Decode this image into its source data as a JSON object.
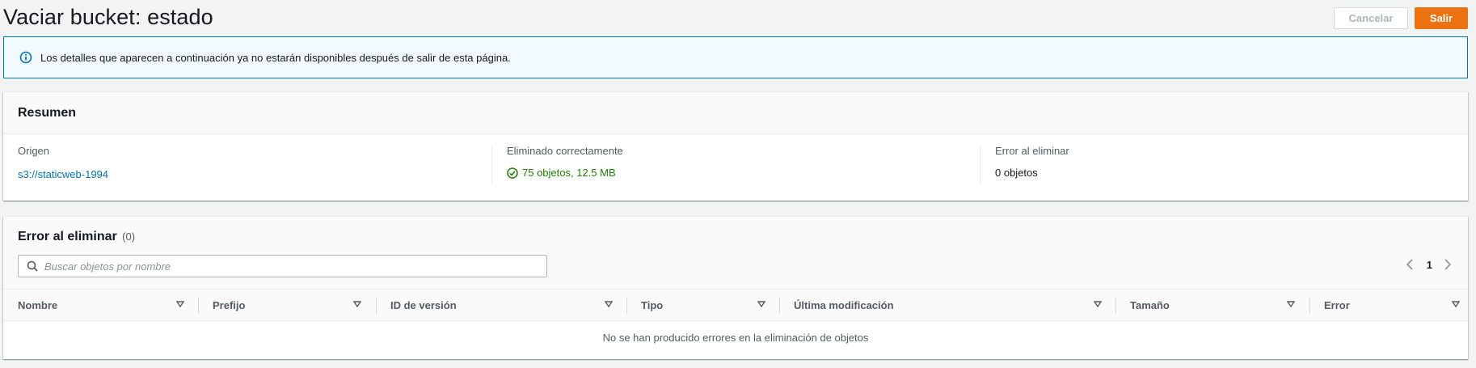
{
  "header": {
    "title": "Vaciar bucket: estado",
    "cancel_label": "Cancelar",
    "exit_label": "Salir"
  },
  "alert": {
    "icon": "info-icon",
    "text": "Los detalles que aparecen a continuación ya no estarán disponibles después de salir de esta página."
  },
  "summary": {
    "title": "Resumen",
    "source_label": "Origen",
    "source_value": "s3://staticweb-1994",
    "success_label": "Eliminado correctamente",
    "success_value": "75 objetos, 12.5 MB",
    "error_label": "Error al eliminar",
    "error_value": "0 objetos"
  },
  "errors": {
    "title": "Error al eliminar",
    "count": "(0)",
    "search_placeholder": "Buscar objetos por nombre",
    "page": "1",
    "columns": [
      "Nombre",
      "Prefijo",
      "ID de versión",
      "Tipo",
      "Última modificación",
      "Tamaño",
      "Error"
    ],
    "empty_message": "No se han producido errores en la eliminación de objetos"
  },
  "colors": {
    "accent": "#ec7211",
    "link": "#0073bb",
    "success": "#1d8102",
    "alert_border": "#0073bb"
  }
}
